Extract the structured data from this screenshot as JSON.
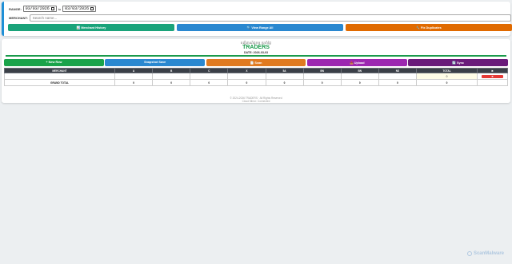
{
  "filters": {
    "range_label": "RANGE:",
    "from_date": "03/03/2026",
    "to_label": "to",
    "to_date": "03/03/2026",
    "merchant_label": "MERCHANT:",
    "search_placeholder": "Search name...",
    "actions": [
      {
        "label": "📊 Merchant History",
        "color": "#1aa37a"
      },
      {
        "label": "🔍 View Range All",
        "color": "#2a88d0"
      },
      {
        "label": "🔧 Fix Duplicates",
        "color": "#e06a00"
      }
    ]
  },
  "report": {
    "native_title": "បញ្ជីពាណិជ្ជកម្ម ប្រចាំថ្ងៃ",
    "brand": "TRADERS",
    "date_line": "DATE: 2026-03-03",
    "tools": [
      {
        "label": "+ New Row",
        "color": "#1aa34a"
      },
      {
        "label": "Snapshot Save",
        "color": "#2a88d0"
      },
      {
        "label": "📄 Scan",
        "color": "#e07a20"
      },
      {
        "label": "📤 Upload",
        "color": "#9c27b0"
      },
      {
        "label": "🔄 Sync",
        "color": "#6a1b7a"
      }
    ],
    "columns": [
      "MERCHANT",
      "A",
      "B",
      "C",
      "X",
      "5A",
      "BN",
      "BN",
      "NS",
      "TOTAL",
      "✖"
    ],
    "row": {
      "merchant": "",
      "cells": [
        "",
        "",
        "",
        "",
        "",
        "",
        "",
        ""
      ],
      "total": "0",
      "delete": "✖"
    },
    "grand": {
      "label": "GRAND TOTAL",
      "cells": [
        "0",
        "0",
        "0",
        "0",
        "0",
        "0",
        "0",
        "0"
      ],
      "total": "0"
    }
  },
  "footer": {
    "line1": "© 2024-2026 TRADERS · All Rights Reserved",
    "line2": "Cloud Mirror: Connected"
  },
  "watermark": "ScanMalware"
}
